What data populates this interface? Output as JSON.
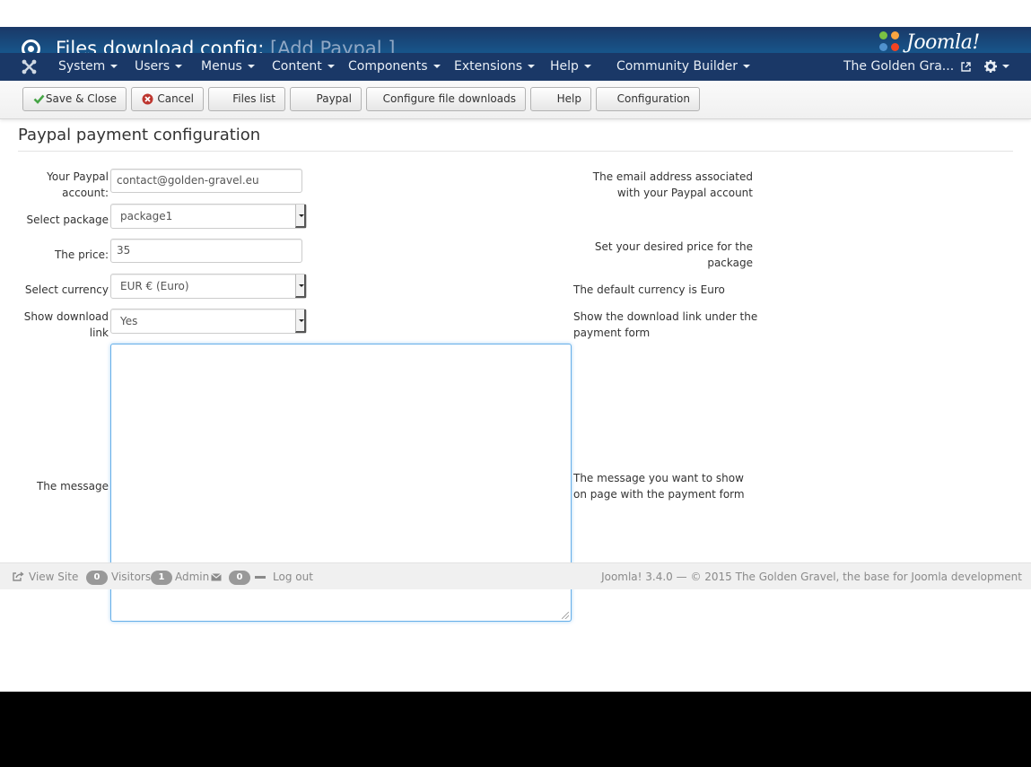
{
  "header": {
    "title": "Files download config:",
    "subtitle": "[Add Paypal ]",
    "brand": "Joomla!"
  },
  "nav": {
    "items": [
      {
        "label": "System"
      },
      {
        "label": "Users"
      },
      {
        "label": "Menus"
      },
      {
        "label": "Content"
      },
      {
        "label": "Components"
      },
      {
        "label": "Extensions"
      },
      {
        "label": "Help"
      },
      {
        "label": "Community Builder"
      }
    ],
    "site_link": "The Golden Gra..."
  },
  "toolbar": {
    "save_close": "Save & Close",
    "cancel": "Cancel",
    "files_list": "Files list",
    "paypal": "Paypal",
    "configure_downloads": "Configure file downloads",
    "help": "Help",
    "configuration": "Configuration"
  },
  "page": {
    "heading": "Paypal payment configuration"
  },
  "form": {
    "paypal_account": {
      "label_line1": "Your Paypal",
      "label_line2": "account:",
      "value": "contact@golden-gravel.eu",
      "hint_line1": "The email address associated",
      "hint_line2": "with your Paypal account"
    },
    "package": {
      "label": "Select package",
      "value": "package1"
    },
    "price": {
      "label": "The price:",
      "value": "35",
      "hint_line1": "Set your desired price for the",
      "hint_line2": "package"
    },
    "currency": {
      "label": "Select currency",
      "value": "EUR € (Euro)",
      "hint": "The default currency is Euro"
    },
    "show_download": {
      "label_line1": "Show download",
      "label_line2": "link",
      "value": "Yes",
      "hint_line1": "Show the download link under the",
      "hint_line2": "payment form"
    },
    "message": {
      "label": "The message",
      "value": "",
      "hint_line1": "The message you want to show",
      "hint_line2": "on page with the payment form"
    }
  },
  "statusbar": {
    "view_site": "View Site",
    "visitors_count": "0",
    "visitors_label": "Visitors",
    "admin_count": "1",
    "admin_label": "Admin",
    "messages_count": "0",
    "logout": "Log out",
    "footer": "Joomla! 3.4.0  —  © 2015 The Golden Gravel, the base for Joomla development"
  },
  "colors": {
    "header_bg": "#17568c",
    "navbar_bg": "#1a3867",
    "focus_border": "#66afe9",
    "save_check": "#46a546",
    "cancel_red": "#bd362f"
  }
}
